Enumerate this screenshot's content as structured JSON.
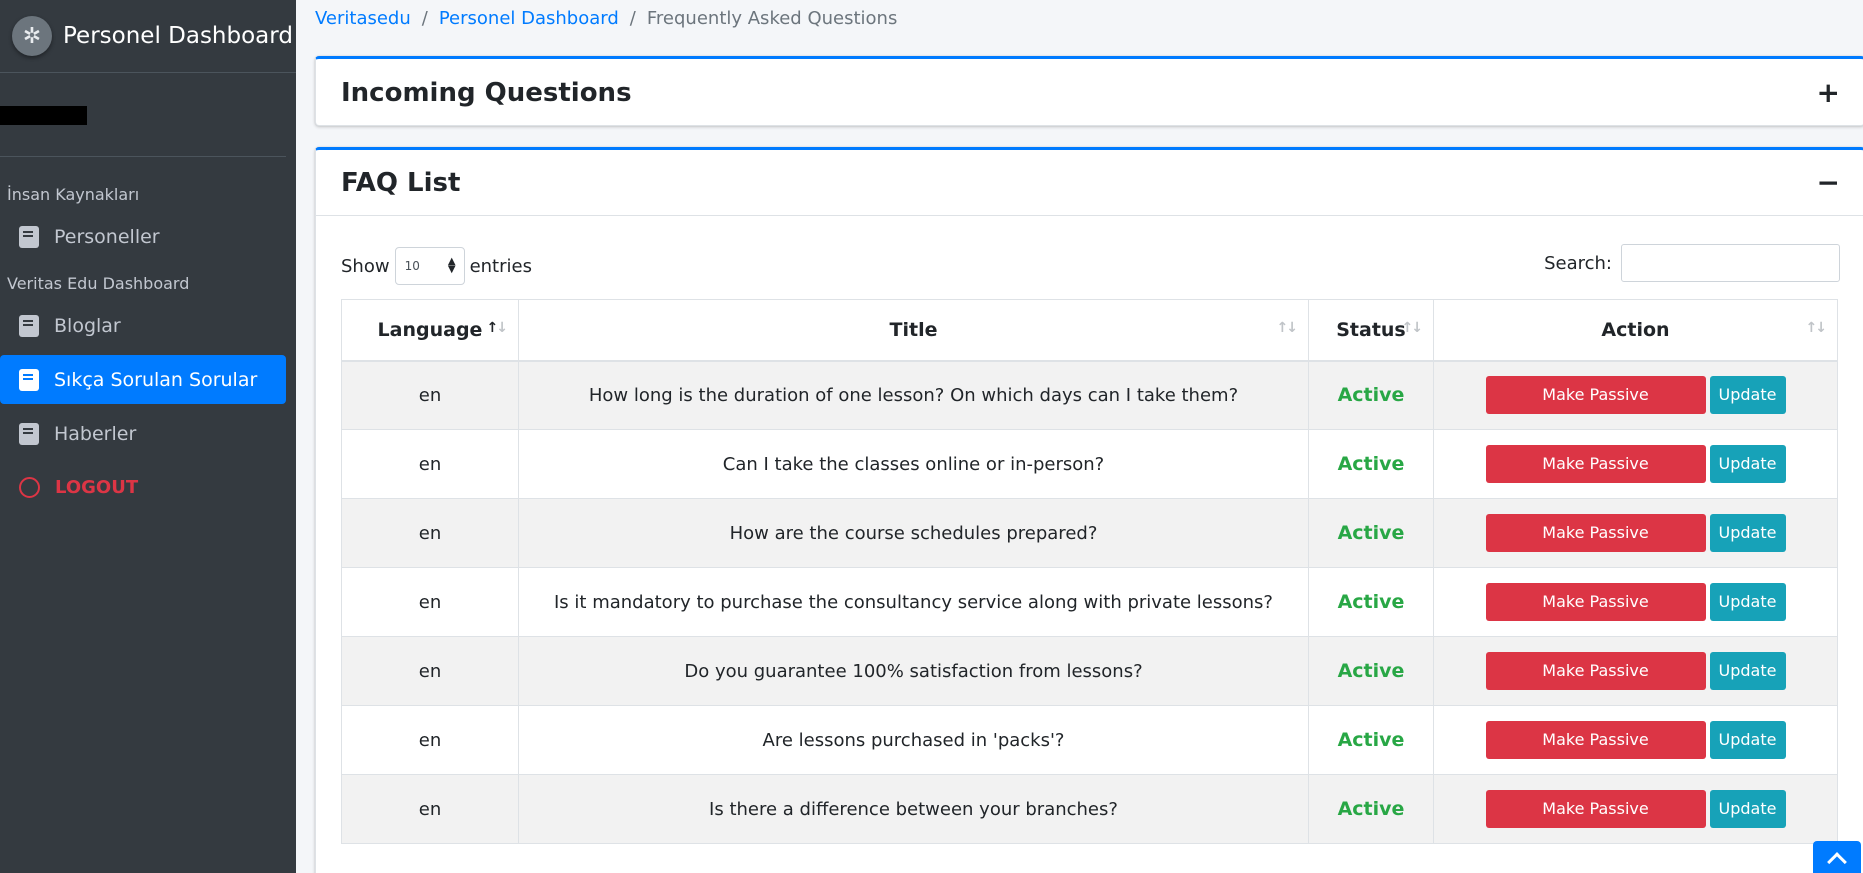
{
  "brand": {
    "title": "Personel Dashboard",
    "logo_icon": "crest-logo-icon"
  },
  "sidebar": {
    "groups": [
      {
        "header": "İnsan Kaynakları",
        "items": [
          {
            "label": "Personeller",
            "icon": "book-icon"
          }
        ]
      },
      {
        "header": "Veritas Edu Dashboard",
        "items": [
          {
            "label": "Bloglar",
            "icon": "book-icon"
          },
          {
            "label": "Sıkça Sorulan Sorular",
            "icon": "book-icon",
            "active": true
          },
          {
            "label": "Haberler",
            "icon": "book-icon"
          }
        ]
      }
    ],
    "logout_label": "LOGOUT"
  },
  "breadcrumb": {
    "items": [
      "Veritasedu",
      "Personel Dashboard"
    ],
    "current": "Frequently Asked Questions",
    "separator": "/"
  },
  "incoming_card": {
    "title": "Incoming Questions",
    "tool": "+"
  },
  "faq_card": {
    "title": "FAQ List",
    "tool": "−",
    "show_label": "Show",
    "page_length": "10",
    "entries_label": "entries",
    "search_label": "Search:",
    "search_value": "",
    "columns": [
      "Language",
      "Title",
      "Status",
      "Action"
    ],
    "rows": [
      {
        "language": "en",
        "title": "How long is the duration of one lesson? On which days can I take them?",
        "status": "Active"
      },
      {
        "language": "en",
        "title": "Can I take the classes online or in-person?",
        "status": "Active"
      },
      {
        "language": "en",
        "title": "How are the course schedules prepared?",
        "status": "Active"
      },
      {
        "language": "en",
        "title": "Is it mandatory to purchase the consultancy service along with private lessons?",
        "status": "Active"
      },
      {
        "language": "en",
        "title": "Do you guarantee 100% satisfaction from lessons?",
        "status": "Active"
      },
      {
        "language": "en",
        "title": "Are lessons purchased in 'packs'?",
        "status": "Active"
      },
      {
        "language": "en",
        "title": "Is there a difference between your branches?",
        "status": "Active"
      }
    ],
    "action_primary": "Make Passive",
    "action_secondary": "Update"
  },
  "colors": {
    "accent": "#007bff",
    "danger": "#dc3545",
    "info": "#17a2b8",
    "success": "#28a745",
    "sidebar": "#343a40"
  }
}
